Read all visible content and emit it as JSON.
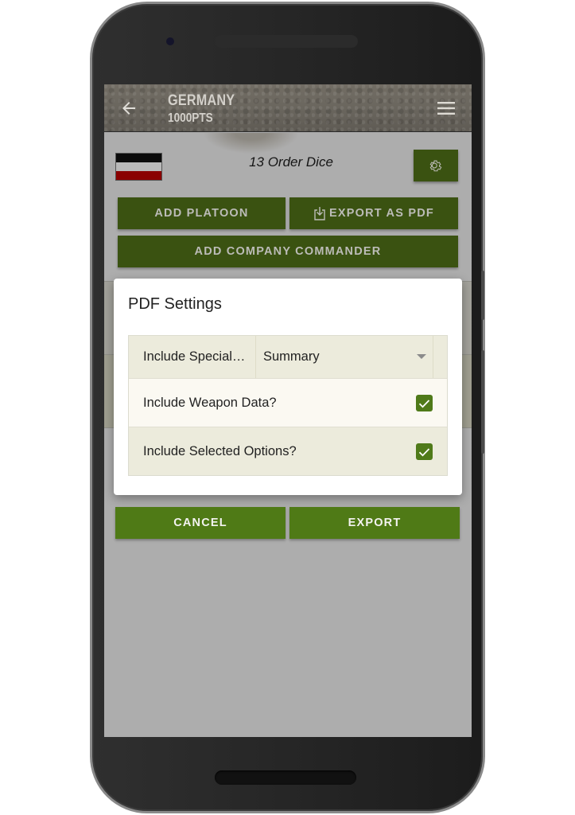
{
  "app": {
    "title": "GERMANY",
    "subtitle": "1000PTS",
    "back_icon": "arrow-left-icon",
    "menu_icon": "hamburger-menu-icon"
  },
  "army": {
    "flag": "german-imperial-flag",
    "flag_colors": [
      "#0b0b0b",
      "#ffffff",
      "#b00000"
    ],
    "order_dice": "13 Order Dice",
    "settings_icon": "gear-icon"
  },
  "actions": {
    "add_platoon": "ADD PLATOON",
    "export_pdf": "EXPORT AS PDF",
    "export_pdf_icon": "download-icon",
    "add_company_commander": "ADD COMPANY COMMANDER"
  },
  "dialog": {
    "title": "PDF Settings",
    "settings": [
      {
        "label": "Include Special…",
        "type": "select",
        "value": "Summary"
      },
      {
        "label": "Include Weapon Data?",
        "type": "checkbox",
        "checked": true
      },
      {
        "label": "Include Selected Options?",
        "type": "checkbox",
        "checked": true
      }
    ],
    "cancel": "CANCEL",
    "export": "EXPORT"
  },
  "colors": {
    "primary_green": "#4f7a16",
    "dimmed_green": "#3a5211",
    "scrim": "#adadad"
  }
}
